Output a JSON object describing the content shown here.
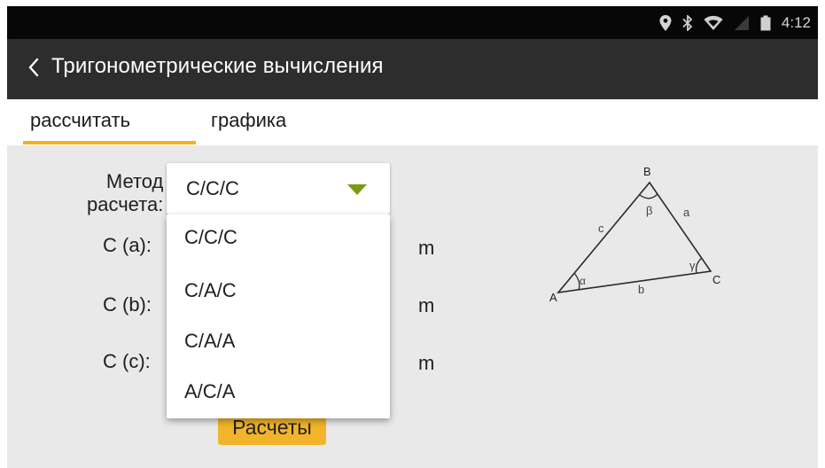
{
  "status_bar": {
    "time": "4:12",
    "icons": [
      "location-icon",
      "bluetooth-icon",
      "wifi-icon",
      "signal-icon",
      "battery-icon"
    ]
  },
  "app_bar": {
    "title": "Тригонометрические вычисления",
    "back_icon": "back-chevron-icon"
  },
  "tabs": [
    {
      "label": "рассчитать",
      "active": true
    },
    {
      "label": "графика",
      "active": false
    }
  ],
  "form": {
    "method_label_line1": "Метод",
    "method_label_line2": "расчета:",
    "selected_method": "С/С/С",
    "fields": [
      {
        "label": "С (a):",
        "unit": "m"
      },
      {
        "label": "С (b):",
        "unit": "m"
      },
      {
        "label": "С (c):",
        "unit": "m"
      }
    ],
    "calculate_label": "Расчеты"
  },
  "dropdown": {
    "options": [
      "С/С/С",
      "С/А/С",
      "С/А/А",
      "А/С/А"
    ]
  },
  "diagram": {
    "vertex_a": "A",
    "vertex_b": "B",
    "vertex_c": "C",
    "side_a": "a",
    "side_b": "b",
    "side_c": "c",
    "angle_alpha": "α",
    "angle_beta": "β",
    "angle_gamma": "γ"
  },
  "colors": {
    "accent": "#f2b21b",
    "app_bar": "#2d2d2d",
    "status_bar": "#070707",
    "content_bg": "#e9e9e9",
    "dropdown_arrow": "#7a9a16"
  }
}
